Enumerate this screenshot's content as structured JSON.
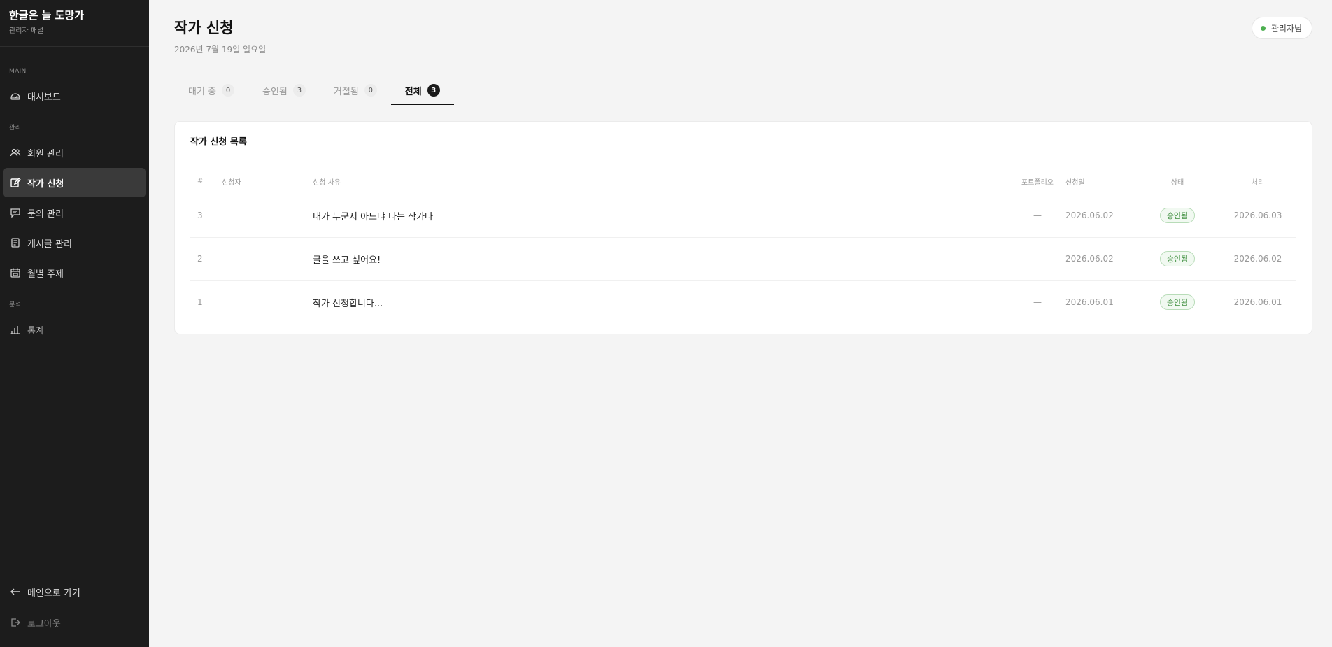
{
  "brand": {
    "title": "한글은 늘 도망가",
    "subtitle": "관리자 패널"
  },
  "sidebar": {
    "sections": [
      {
        "label": "MAIN"
      },
      {
        "label": "관리"
      },
      {
        "label": "분석"
      }
    ],
    "items": [
      {
        "label": "대시보드",
        "icon": "dashboard-icon"
      },
      {
        "label": "회원 관리",
        "icon": "users-icon"
      },
      {
        "label": "작가 신청",
        "icon": "edit-icon",
        "active": true
      },
      {
        "label": "문의 관리",
        "icon": "message-icon"
      },
      {
        "label": "게시글 관리",
        "icon": "document-icon"
      },
      {
        "label": "월별 주제",
        "icon": "calendar-icon"
      },
      {
        "label": "통계",
        "icon": "bar-chart-icon"
      }
    ],
    "footer": {
      "main_label": "메인으로 가기",
      "logout_label": "로그아웃"
    }
  },
  "header": {
    "title": "작가 신청",
    "date": "2026년 7월 19일 일요일",
    "admin_label": "관리자님",
    "status_color": "#4caf50"
  },
  "tabs": [
    {
      "label": "대기 중",
      "count": "0"
    },
    {
      "label": "승인됨",
      "count": "3"
    },
    {
      "label": "거절됨",
      "count": "0"
    },
    {
      "label": "전체",
      "count": "3",
      "active": true
    }
  ],
  "card": {
    "title": "작가 신청 목록",
    "columns": [
      "#",
      "신청자",
      "신청 사유",
      "포트폴리오",
      "신청일",
      "상태",
      "처리"
    ],
    "rows": [
      {
        "num": "3",
        "applicant": "",
        "reason": "내가 누군지 아느냐 나는 작가다",
        "portfolio": "—",
        "date": "2026.06.02",
        "status": "승인됨",
        "processed": "2026.06.03"
      },
      {
        "num": "2",
        "applicant": "",
        "reason": "글을 쓰고 싶어요!",
        "portfolio": "—",
        "date": "2026.06.02",
        "status": "승인됨",
        "processed": "2026.06.02"
      },
      {
        "num": "1",
        "applicant": "",
        "reason": "작가 신청합니다...",
        "portfolio": "—",
        "date": "2026.06.01",
        "status": "승인됨",
        "processed": "2026.06.01"
      }
    ]
  }
}
